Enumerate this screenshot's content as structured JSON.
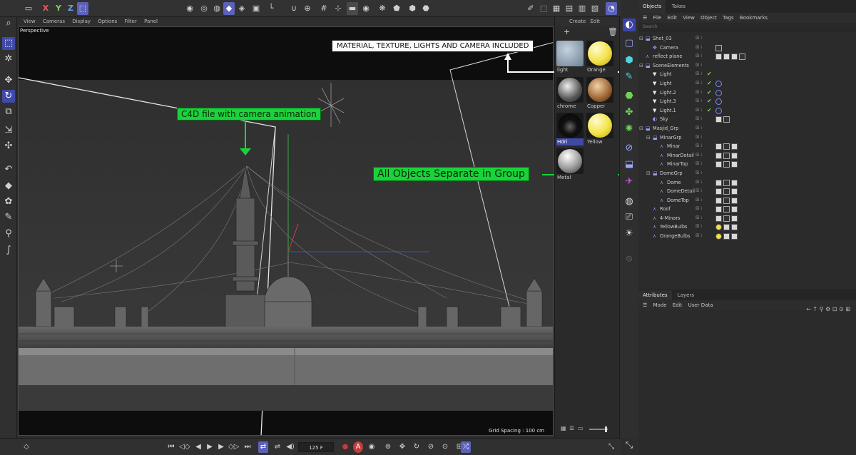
{
  "toolbar": {
    "axis_x": "X",
    "axis_y": "Y",
    "axis_z": "Z"
  },
  "viewport": {
    "menu": [
      "View",
      "Cameras",
      "Display",
      "Options",
      "Filter",
      "Panel"
    ],
    "camera_label": "Perspective",
    "grid_spacing": "Grid Spacing : 100 cm"
  },
  "annotations": {
    "camera_anim": "C4D file with camera animation",
    "objects_group": "All Objects Separate in Group",
    "included": "MATERIAL, TEXTURE, LIGHTS AND CAMERA INCLUDED"
  },
  "material_manager": {
    "menu": [
      "Create",
      "Edit"
    ],
    "materials": [
      {
        "name": "light",
        "color": "#8fa2b8"
      },
      {
        "name": "Orange",
        "color": "#f2e24a"
      },
      {
        "name": "chrome",
        "color": "#9a9a9a"
      },
      {
        "name": "Copper",
        "color": "#b07845"
      },
      {
        "name": "Hdri",
        "color": "#151515"
      },
      {
        "name": "Yellow",
        "color": "#f3e447"
      },
      {
        "name": "Metal",
        "color": "#c8c8c8"
      }
    ]
  },
  "objects_panel": {
    "tabs": [
      "Objects",
      "Takes"
    ],
    "menu": [
      "File",
      "Edit",
      "View",
      "Object",
      "Tags",
      "Bookmarks"
    ],
    "search_placeholder": "Search",
    "rows": [
      {
        "name": "Shot_03",
        "indent": 0,
        "icon": "camera-group-icon"
      },
      {
        "name": "Camera",
        "indent": 1,
        "icon": "camera-icon"
      },
      {
        "name": "reflect plane",
        "indent": 0,
        "icon": "plane-icon"
      },
      {
        "name": "SceneElements",
        "indent": 0,
        "icon": "group-icon"
      },
      {
        "name": "Light",
        "indent": 1,
        "icon": "light-icon"
      },
      {
        "name": "Light",
        "indent": 1,
        "icon": "light-icon"
      },
      {
        "name": "Light.2",
        "indent": 1,
        "icon": "light-icon"
      },
      {
        "name": "Light.3",
        "indent": 1,
        "icon": "light-icon"
      },
      {
        "name": "Light.1",
        "indent": 1,
        "icon": "light-icon"
      },
      {
        "name": "Sky",
        "indent": 1,
        "icon": "sky-icon"
      },
      {
        "name": "Masjid_Grp",
        "indent": 0,
        "icon": "group-icon"
      },
      {
        "name": "MinarGrp",
        "indent": 1,
        "icon": "group-icon"
      },
      {
        "name": "Minar",
        "indent": 2,
        "icon": "mesh-icon"
      },
      {
        "name": "MinarDetail",
        "indent": 2,
        "icon": "mesh-icon"
      },
      {
        "name": "MinarTop",
        "indent": 2,
        "icon": "mesh-icon"
      },
      {
        "name": "DomeGrp",
        "indent": 1,
        "icon": "group-icon"
      },
      {
        "name": "Dome",
        "indent": 2,
        "icon": "mesh-icon"
      },
      {
        "name": "DomeDetail",
        "indent": 2,
        "icon": "mesh-icon"
      },
      {
        "name": "DomeTop",
        "indent": 2,
        "icon": "mesh-icon"
      },
      {
        "name": "Roof",
        "indent": 1,
        "icon": "mesh-icon"
      },
      {
        "name": "4-Minars",
        "indent": 1,
        "icon": "mesh-icon"
      },
      {
        "name": "YellowBulbs",
        "indent": 1,
        "icon": "mesh-icon"
      },
      {
        "name": "OrangeBulbs",
        "indent": 1,
        "icon": "mesh-icon"
      }
    ]
  },
  "attributes_panel": {
    "tabs": [
      "Attributes",
      "Layers"
    ],
    "menu": [
      "Mode",
      "Edit",
      "User Data"
    ]
  },
  "timeline": {
    "current_frame": "125 F"
  }
}
